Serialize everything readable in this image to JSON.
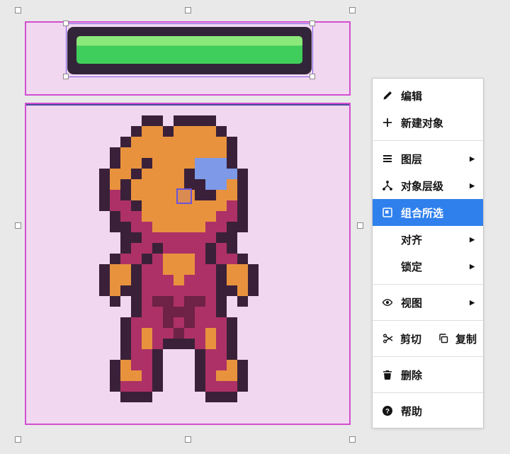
{
  "colors": {
    "page_bg": "#E9E9E9",
    "object_pink": "#F2D7F0",
    "selection_magenta": "#D24FD0",
    "selection_purple": "#7B5BE8",
    "pivot_purple": "#6B55D8",
    "bottom_top_line": "#474B9B",
    "menu_bg": "#FFFFFF",
    "menu_border": "#C8C8C8",
    "menu_text": "#141414",
    "menu_active_bg": "#2F80ED",
    "menu_active_text": "#FFFFFF",
    "divider": "#DEDEDE",
    "hb_frame": "#332539",
    "hb_green": "#3FCE5B",
    "hb_green_light": "#8BE87A",
    "handle_fill": "#FFFFFF",
    "handle_border": "#8A8A8A"
  },
  "sprite": {
    "palette": {
      "K": "#3A2139",
      "O": "#E8923E",
      "M": "#AD3166",
      "R": "#6E2245",
      "B": "#7D99E8"
    },
    "rows": [
      "....KK.KKKK......",
      "...KOOKOOOOK.....",
      "..KOOOOOOOOOK....",
      ".KOOOOOOOOOOK....",
      ".KOOKOOOOBBBK....",
      "KOOKOOOOKBBBBK...",
      "KOKOOOOOKKBBOK...",
      "KMKOOOOOOKKOOK...",
      "KMMKOOOOOOOOMK...",
      ".KMMOOOOOOOMMK...",
      ".KKMMOOOOOMMKK...",
      "..KKMMMMMMMKK....",
      "..KMMKMMMMKMK....",
      ".KMMKMOOOMKMMK...",
      "KOOKMMOOOMMKOOK..",
      "KOOKMMMOMMMKOOK..",
      "KOKKMMMMMMMKKOK..",
      ".K.KMRRMRRMK.K...",
      "...KMMRRRMMK.....",
      "..KMMMRMRMMMK....",
      "..KMOMMRMMOMK....",
      "..KMOMKKKMOMK....",
      "..KMMK...KMMK....",
      ".KOMMK...KMMOK...",
      ".KOOMK...KMOOK...",
      ".KMMMK...KMMMK...",
      "..KKK.....KKK....",
      "................."
    ]
  },
  "menu": {
    "submenu_arrow": "▶",
    "items": [
      {
        "type": "item",
        "key": "edit",
        "label": "编辑",
        "icon": "pencil-icon"
      },
      {
        "type": "item",
        "key": "new-object",
        "label": "新建对象",
        "icon": "plus-icon"
      },
      {
        "type": "divider"
      },
      {
        "type": "item",
        "key": "layers",
        "label": "图层",
        "icon": "layers-icon",
        "submenu": true
      },
      {
        "type": "item",
        "key": "object-hierarchy",
        "label": "对象层级",
        "icon": "hierarchy-icon",
        "submenu": true
      },
      {
        "type": "item",
        "key": "group-selection",
        "label": "组合所选",
        "icon": "group-icon",
        "active": true
      },
      {
        "type": "item",
        "key": "align",
        "label": "对齐",
        "submenu": true
      },
      {
        "type": "item",
        "key": "lock",
        "label": "锁定",
        "submenu": true
      },
      {
        "type": "divider"
      },
      {
        "type": "item",
        "key": "view",
        "label": "视图",
        "icon": "eye-icon",
        "submenu": true
      },
      {
        "type": "divider"
      },
      {
        "type": "pair",
        "items": [
          {
            "key": "cut",
            "label": "剪切",
            "icon": "scissors-icon"
          },
          {
            "key": "copy",
            "label": "复制",
            "icon": "copy-icon"
          }
        ]
      },
      {
        "type": "divider"
      },
      {
        "type": "item",
        "key": "delete",
        "label": "删除",
        "icon": "trash-icon"
      },
      {
        "type": "divider"
      },
      {
        "type": "item",
        "key": "help",
        "label": "帮助",
        "icon": "help-icon"
      }
    ]
  }
}
